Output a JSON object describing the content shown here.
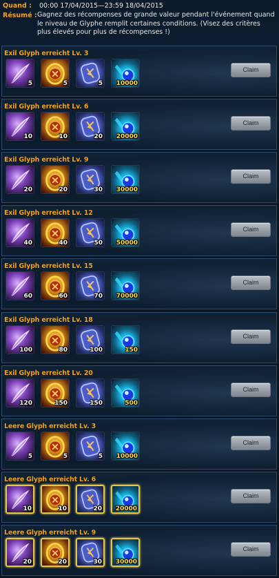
{
  "header": {
    "when_label": "Quand :",
    "when_value": "00:00 17/04/2015—23:59 18/04/2015",
    "summary_label": "Résumé :",
    "summary_text": "Gagnez des récompenses de grande valeur pendant l'événement quand le niveau de Glyphe remplit certaines conditions. (Visez des critères plus élevés pour plus de récompenses !)"
  },
  "claim_label": "Claim",
  "rows": [
    {
      "title": "Exil Glyph erreicht Lv. 3",
      "frame": "plain",
      "items": [
        {
          "icon": "feather-icon",
          "count": "5"
        },
        {
          "icon": "medal-icon",
          "count": "5"
        },
        {
          "icon": "rune-icon",
          "count": "5"
        },
        {
          "icon": "blue-orb-icon",
          "count": "10000"
        }
      ]
    },
    {
      "title": "Exil Glyph erreicht Lv. 6",
      "frame": "plain",
      "items": [
        {
          "icon": "feather-icon",
          "count": "10"
        },
        {
          "icon": "medal-icon",
          "count": "10"
        },
        {
          "icon": "rune-icon",
          "count": "20"
        },
        {
          "icon": "blue-orb-icon",
          "count": "20000"
        }
      ]
    },
    {
      "title": "Exil Glyph erreicht Lv. 9",
      "frame": "plain",
      "items": [
        {
          "icon": "feather-icon",
          "count": "20"
        },
        {
          "icon": "medal-icon",
          "count": "20"
        },
        {
          "icon": "rune-icon",
          "count": "30"
        },
        {
          "icon": "blue-orb-icon",
          "count": "30000"
        }
      ]
    },
    {
      "title": "Exil Glyph erreicht Lv. 12",
      "frame": "plain",
      "items": [
        {
          "icon": "feather-icon",
          "count": "40"
        },
        {
          "icon": "medal-icon",
          "count": "40"
        },
        {
          "icon": "rune-icon",
          "count": "50"
        },
        {
          "icon": "blue-orb-icon",
          "count": "50000"
        }
      ]
    },
    {
      "title": "Exil Glyph erreicht Lv. 15",
      "frame": "plain",
      "items": [
        {
          "icon": "feather-icon",
          "count": "60"
        },
        {
          "icon": "medal-icon",
          "count": "60"
        },
        {
          "icon": "rune-icon",
          "count": "70"
        },
        {
          "icon": "blue-orb-icon",
          "count": "70000"
        }
      ]
    },
    {
      "title": "Exil Glyph erreicht Lv. 18",
      "frame": "plain",
      "items": [
        {
          "icon": "feather-icon",
          "count": "100"
        },
        {
          "icon": "medal-icon",
          "count": "80"
        },
        {
          "icon": "rune-icon",
          "count": "100"
        },
        {
          "icon": "blue-orb-icon",
          "count": "150"
        }
      ]
    },
    {
      "title": "Exil Glyph erreicht Lv. 20",
      "frame": "plain",
      "items": [
        {
          "icon": "feather-icon",
          "count": "120"
        },
        {
          "icon": "medal-icon",
          "count": "150"
        },
        {
          "icon": "rune-icon",
          "count": "150"
        },
        {
          "icon": "blue-orb-icon",
          "count": "500"
        }
      ]
    },
    {
      "title": "Leere Glyph erreicht Lv. 3",
      "frame": "plain",
      "items": [
        {
          "icon": "feather-icon",
          "count": "5"
        },
        {
          "icon": "medal-icon",
          "count": "5"
        },
        {
          "icon": "rune-icon",
          "count": "5"
        },
        {
          "icon": "blue-orb-icon",
          "count": "10000"
        }
      ]
    },
    {
      "title": "Leere Glyph erreicht Lv. 6",
      "frame": "gold",
      "items": [
        {
          "icon": "feather-icon",
          "count": "10"
        },
        {
          "icon": "medal-icon",
          "count": "10"
        },
        {
          "icon": "rune-icon",
          "count": "20"
        },
        {
          "icon": "blue-orb-icon",
          "count": "20000"
        }
      ]
    },
    {
      "title": "Leere Glyph erreicht Lv. 9",
      "frame": "gold",
      "items": [
        {
          "icon": "feather-icon",
          "count": "20"
        },
        {
          "icon": "medal-icon",
          "count": "20"
        },
        {
          "icon": "rune-icon",
          "count": "30"
        },
        {
          "icon": "blue-orb-icon",
          "count": "30000"
        }
      ]
    }
  ],
  "colors": {
    "accent": "#f2a31a",
    "background": "#0a1626",
    "row_border": "#2c4d6e"
  }
}
